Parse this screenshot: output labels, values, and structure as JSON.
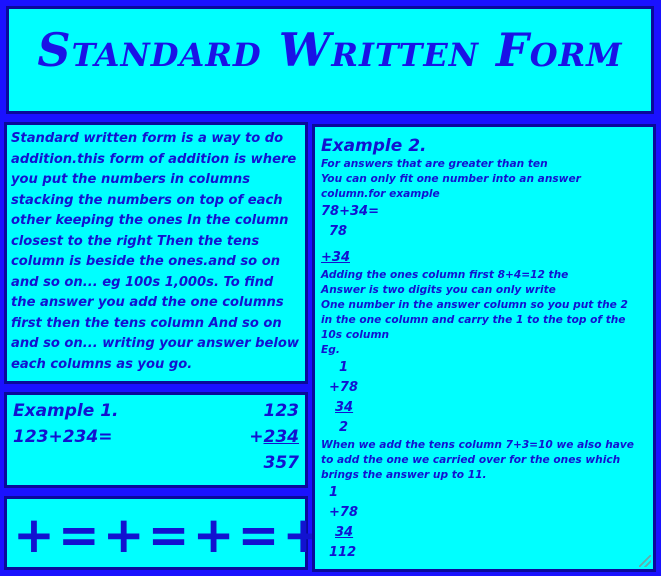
{
  "title": "Standard Written Form",
  "intro": "Standard written form is a way to do addition.this form of addition is where you put the numbers in columns stacking the numbers on top of each other keeping the ones In the column closest to the right Then the tens column is beside the ones.and so on and so on... eg 100s 1,000s. To find the answer you add the one columns first then the tens column And so on and so on... writing your answer below each columns as you go.",
  "example1": {
    "title": "Example 1.",
    "equation": "123+234=",
    "top": "123",
    "plus": "+",
    "bottom": "234",
    "sum": "357"
  },
  "symbols": "+=+=+=+",
  "example2": {
    "title": "Example 2.",
    "intro_lines": [
      "For answers that are greater than ten",
      "You can only fit one number into an answer",
      "column.for example"
    ],
    "equation": "78+34=",
    "line_78": "78",
    "line_plus34": "+34",
    "explain_lines": [
      "Adding the ones column first 8+4=12 the",
      "Answer is two digits you can only write",
      "One number in the answer column so you put the 2",
      "in the one column and carry the 1 to the top of the",
      "10s column"
    ],
    "eg": "Eg.",
    "calc1": {
      "carry": "1",
      "top": "+78",
      "bottom": "34",
      "result": "2"
    },
    "tens_lines": [
      "When we add the tens column 7+3=10 we also have",
      "to add the one we carried over for the ones which",
      "brings the answer up to 11."
    ],
    "calc2": {
      "carry": "1",
      "top": "+78",
      "bottom": "34",
      "result": "112"
    }
  }
}
